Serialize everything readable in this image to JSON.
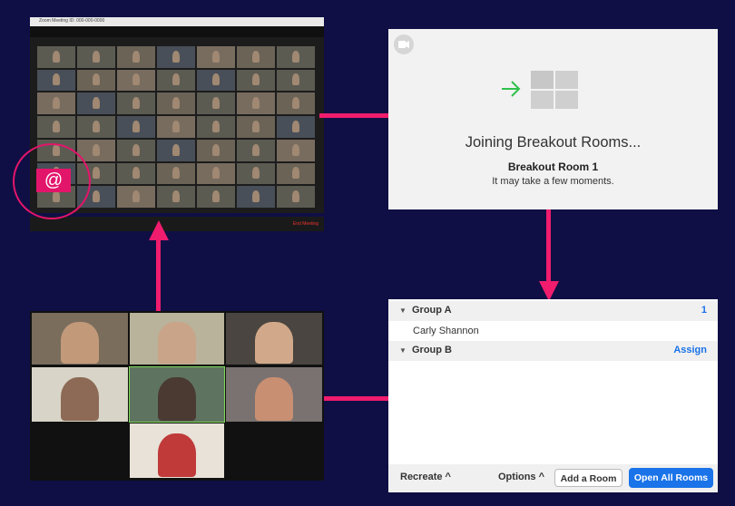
{
  "main_window": {
    "title": "Zoom Meeting ID: 000-000-0000",
    "topic": "Marvellous Inbox-Zero-Party",
    "end_meeting": "End Meeting"
  },
  "mention_icon": "@",
  "joining": {
    "title": "Joining Breakout Rooms...",
    "room": "Breakout Room 1",
    "subtitle": "It may take a few moments."
  },
  "breakout_panel": {
    "groups": [
      {
        "name": "Group A",
        "value": "1",
        "members": [
          "Carly Shannon"
        ]
      },
      {
        "name": "Group B",
        "value": "Assign",
        "members": []
      }
    ],
    "recreate_label": "Recreate",
    "options_label": "Options",
    "add_room_label": "Add a Room",
    "open_all_label": "Open All Rooms"
  },
  "breakout_gallery": {
    "participants": [
      "",
      "",
      "",
      "",
      "",
      "",
      ""
    ]
  },
  "colors": {
    "arrow": "#f01c6d",
    "accent_blue": "#1a73e8",
    "enter_arrow": "#2fc14b"
  }
}
